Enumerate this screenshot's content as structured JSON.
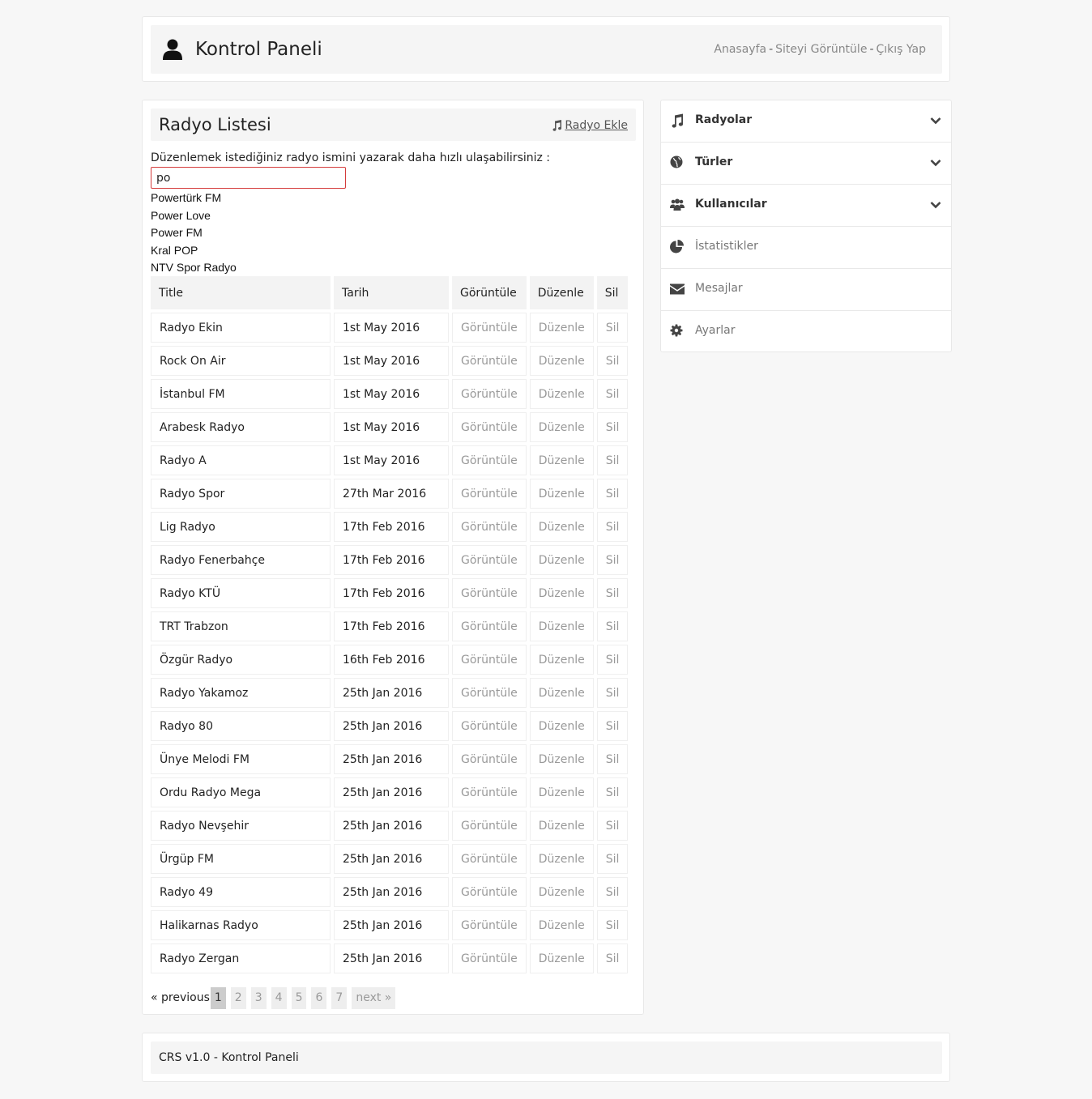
{
  "header": {
    "brand": "Kontrol Paneli",
    "nav": [
      {
        "label": "Anasayfa"
      },
      {
        "label": "Siteyi Görüntüle"
      },
      {
        "label": "Çıkış Yap"
      }
    ],
    "separator": "-",
    "icon": "user-icon"
  },
  "panel": {
    "title": "Radyo Listesi",
    "add_label": "Radyo Ekle",
    "search_label": "Düzenlemek istediğiniz radyo ismini yazarak daha hızlı ulaşabilirsiniz :",
    "search_value": "po",
    "suggestions": [
      "Powertürk FM",
      "Power Love",
      "Power FM",
      "Kral POP",
      "NTV Spor Radyo"
    ]
  },
  "table": {
    "headers": [
      "Title",
      "Tarih",
      "Görüntüle",
      "Düzenle",
      "Sil"
    ],
    "action_labels": {
      "view": "Görüntüle",
      "edit": "Düzenle",
      "delete": "Sil"
    },
    "rows": [
      {
        "title": "Radyo Ekin",
        "date": "1st May 2016"
      },
      {
        "title": "Rock On Air",
        "date": "1st May 2016"
      },
      {
        "title": "İstanbul FM",
        "date": "1st May 2016"
      },
      {
        "title": "Arabesk Radyo",
        "date": "1st May 2016"
      },
      {
        "title": "Radyo A",
        "date": "1st May 2016"
      },
      {
        "title": "Radyo Spor",
        "date": "27th Mar 2016"
      },
      {
        "title": "Lig Radyo",
        "date": "17th Feb 2016"
      },
      {
        "title": "Radyo Fenerbahçe",
        "date": "17th Feb 2016"
      },
      {
        "title": "Radyo KTÜ",
        "date": "17th Feb 2016"
      },
      {
        "title": "TRT Trabzon",
        "date": "17th Feb 2016"
      },
      {
        "title": "Özgür Radyo",
        "date": "16th Feb 2016"
      },
      {
        "title": "Radyo Yakamoz",
        "date": "25th Jan 2016"
      },
      {
        "title": "Radyo 80",
        "date": "25th Jan 2016"
      },
      {
        "title": "Ünye Melodi FM",
        "date": "25th Jan 2016"
      },
      {
        "title": "Ordu Radyo Mega",
        "date": "25th Jan 2016"
      },
      {
        "title": "Radyo Nevşehir",
        "date": "25th Jan 2016"
      },
      {
        "title": "Ürgüp FM",
        "date": "25th Jan 2016"
      },
      {
        "title": "Radyo 49",
        "date": "25th Jan 2016"
      },
      {
        "title": "Halikarnas Radyo",
        "date": "25th Jan 2016"
      },
      {
        "title": "Radyo Zergan",
        "date": "25th Jan 2016"
      }
    ]
  },
  "pagination": {
    "previous": "« previous",
    "pages": [
      "1",
      "2",
      "3",
      "4",
      "5",
      "6",
      "7"
    ],
    "current": "1",
    "next": "next »"
  },
  "sidebar": {
    "items": [
      {
        "label": "Radyolar",
        "icon": "music-icon",
        "expandable": true
      },
      {
        "label": "Türler",
        "icon": "globe-icon",
        "expandable": true
      },
      {
        "label": "Kullanıcılar",
        "icon": "users-icon",
        "expandable": true
      },
      {
        "label": "İstatistikler",
        "icon": "pie-chart-icon",
        "expandable": false
      },
      {
        "label": "Mesajlar",
        "icon": "envelope-icon",
        "expandable": false
      },
      {
        "label": "Ayarlar",
        "icon": "gear-icon",
        "expandable": false
      }
    ]
  },
  "footer": {
    "text": "CRS v1.0 - Kontrol Paneli"
  }
}
